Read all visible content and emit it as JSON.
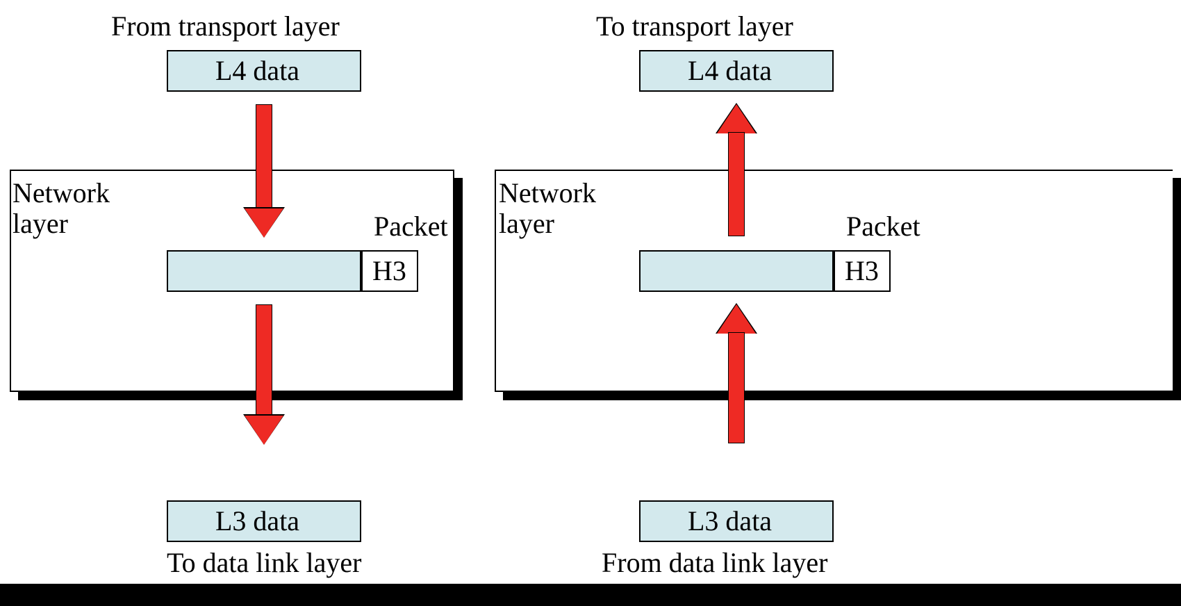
{
  "left": {
    "top_label": "From transport layer",
    "l4": "L4 data",
    "network_layer": "Network\nlayer",
    "packet": "Packet",
    "h3": "H3",
    "l3": "L3 data",
    "bottom_label": "To data link layer"
  },
  "right": {
    "top_label": "To transport layer",
    "l4": "L4 data",
    "network_layer": "Network\nlayer",
    "packet": "Packet",
    "h3": "H3",
    "l3": "L3 data",
    "bottom_label": "From data link layer"
  }
}
